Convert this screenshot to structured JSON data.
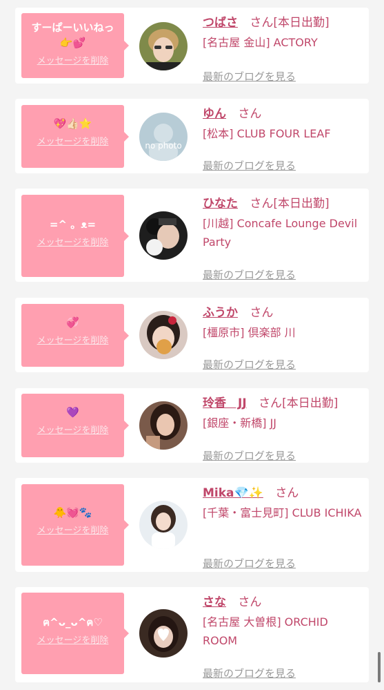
{
  "delete_label": "メッセージを削除",
  "blog_label": "最新のブログを見る",
  "san_label": "さん",
  "today_label": "[本日出勤]",
  "cards": [
    {
      "message": "すーぱーいいねっ\n👉💕",
      "name": "つばさ",
      "shop": "[名古屋 金山] ACTORY",
      "today": true
    },
    {
      "message": "💖👍🏻⭐️",
      "name": "ゆん",
      "shop": "[松本] CLUB FOUR LEAF",
      "today": false,
      "avatar_text": "no photo"
    },
    {
      "message": "=^ 。ᴥ=",
      "name": "ひなた",
      "shop": "[川越] Concafe Lounge Devil Party",
      "today": true
    },
    {
      "message": "💞",
      "name": "ふうか",
      "shop": "[橿原市] 倶楽部 川",
      "today": false
    },
    {
      "message": "💜",
      "name": "玲香　JJ",
      "shop": "[銀座・新橋] JJ",
      "today": true
    },
    {
      "message": "🐥💓🐾",
      "name": "Mika💎✨",
      "shop": "[千葉・富士見町] CLUB ICHIKA",
      "today": false
    },
    {
      "message": "ฅ^ᴗ_ᴗ^ฅ♡",
      "name": "さな",
      "shop": "[名古屋 大曽根] ORCHID ROOM",
      "today": false
    }
  ],
  "colors": {
    "accent": "#c0476a",
    "bubble": "#ff9fb0",
    "link_gray": "#999999"
  }
}
